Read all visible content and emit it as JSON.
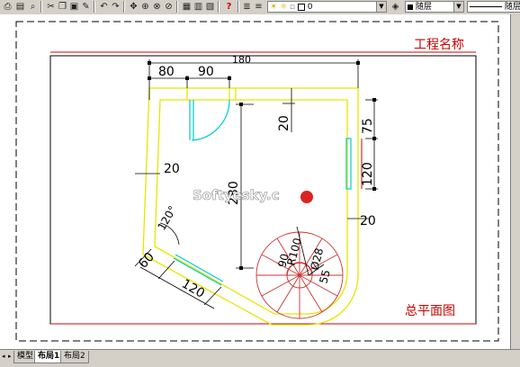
{
  "toolbar": {
    "layer_value": "0",
    "color_value": "随层",
    "linetype_value": "随层",
    "lineweight_value": "随"
  },
  "tabs": {
    "model": "模型",
    "layout1": "布局1",
    "layout2": "布局2"
  },
  "drawing": {
    "title_block_top": "工程名称",
    "title_block_bottom": "总平面图",
    "watermark": "Softyesky.c",
    "dims": {
      "top_total": "180",
      "top_left": "80",
      "top_mid": "90",
      "inner_20": "20",
      "left_20": "20",
      "right_75": "75",
      "right_120": "120",
      "right_20": "20",
      "height_280": "280",
      "angle": "120°",
      "bottom_60": "60",
      "bottom_120": "120",
      "stair_r100": "R100",
      "stair_d28": "Ø28",
      "stair_55": "55",
      "stair_90": "90"
    }
  },
  "colors": {
    "wall": "#e6e600",
    "dimension": "#000000",
    "accent_red": "#cc0000",
    "window_cyan": "#00cccc",
    "stair": "#cc3333"
  }
}
